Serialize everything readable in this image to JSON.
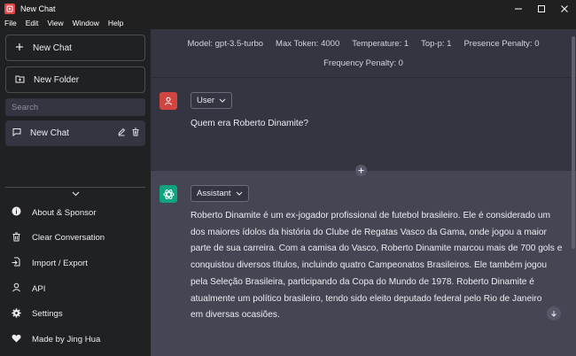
{
  "window": {
    "title": "New Chat"
  },
  "menubar": [
    "File",
    "Edit",
    "View",
    "Window",
    "Help"
  ],
  "sidebar": {
    "new_chat": "New Chat",
    "new_folder": "New Folder",
    "search_placeholder": "Search",
    "chats": [
      {
        "label": "New Chat"
      }
    ],
    "menu": [
      {
        "label": "About & Sponsor",
        "icon": "info-icon"
      },
      {
        "label": "Clear Conversation",
        "icon": "trash-icon"
      },
      {
        "label": "Import / Export",
        "icon": "file-import-icon"
      },
      {
        "label": "API",
        "icon": "user-icon"
      },
      {
        "label": "Settings",
        "icon": "gear-icon"
      },
      {
        "label": "Made by Jing Hua",
        "icon": "heart-icon"
      }
    ]
  },
  "config": {
    "model": "Model: gpt-3.5-turbo",
    "max_token": "Max Token: 4000",
    "temperature": "Temperature: 1",
    "top_p": "Top-p: 1",
    "presence_penalty": "Presence Penalty: 0",
    "frequency_penalty": "Frequency Penalty: 0"
  },
  "messages": [
    {
      "role": "User",
      "text": "Quem era Roberto Dinamite?"
    },
    {
      "role": "Assistant",
      "lines": [
        "Roberto Dinamite é um ex-jogador profissional de futebol brasileiro. Ele é considerado um",
        "dos maiores ídolos da história do Clube de Regatas Vasco da Gama, onde jogou a maior",
        "parte de sua carreira. Com a camisa do Vasco, Roberto Dinamite marcou mais de 700 gols e",
        "conquistou diversos títulos, incluindo quatro Campeonatos Brasileiros. Ele também jogou",
        "pela Seleção Brasileira, participando da Copa do Mundo de 1978. Roberto Dinamite é",
        "atualmente um político brasileiro, tendo sido eleito deputado federal pelo Rio de Janeiro",
        "em diversas ocasiões."
      ]
    }
  ],
  "colors": {
    "user_avatar": "#d0453f",
    "assistant_avatar": "#10a37f",
    "sidebar_bg": "#202123",
    "main_bg": "#343541",
    "assistant_bg": "#444654"
  }
}
